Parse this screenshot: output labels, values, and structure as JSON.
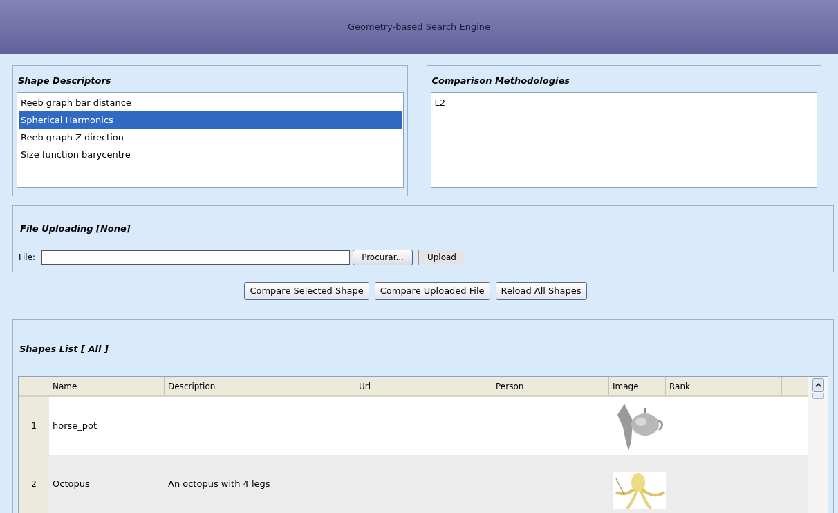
{
  "header": {
    "title": "Geometry-based Search Engine"
  },
  "shape_descriptors": {
    "title": "Shape Descriptors",
    "items": [
      {
        "label": "Reeb graph bar distance",
        "selected": false
      },
      {
        "label": "Spherical Harmonics",
        "selected": true
      },
      {
        "label": "Reeb graph Z direction",
        "selected": false
      },
      {
        "label": "Size function barycentre",
        "selected": false
      }
    ]
  },
  "comparison_methodologies": {
    "title": "Comparison Methodologies",
    "items": [
      {
        "label": "L2",
        "selected": false
      }
    ]
  },
  "file_uploading": {
    "title": "File Uploading [None]",
    "file_label": "File:",
    "browse_button": "Procurar...",
    "upload_button": "Upload"
  },
  "actions": [
    "Compare Selected Shape",
    "Compare Uploaded File",
    "Reload All Shapes"
  ],
  "shapes_list": {
    "title": "Shapes List [ All ]",
    "columns": [
      "Name",
      "Description",
      "Url",
      "Person",
      "Image",
      "Rank"
    ],
    "rows": [
      {
        "index": "1",
        "name": "horse_pot",
        "description": ""
      },
      {
        "index": "2",
        "name": "Octopus",
        "description": "An octopus with 4 legs"
      }
    ]
  }
}
